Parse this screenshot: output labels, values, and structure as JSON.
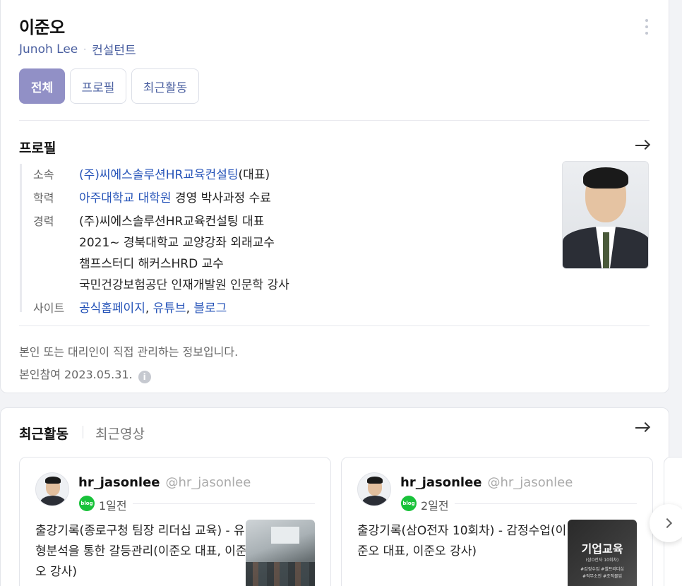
{
  "header": {
    "name": "이준오",
    "english_name": "Junoh Lee",
    "separator": "·",
    "role": "컨설턴트"
  },
  "tabs": [
    {
      "label": "전체",
      "active": true
    },
    {
      "label": "프로필",
      "active": false
    },
    {
      "label": "최근활동",
      "active": false
    }
  ],
  "profile": {
    "title": "프로필",
    "affiliation_label": "소속",
    "affiliation_link": "(주)씨에스솔루션HR교육컨설팅",
    "affiliation_suffix": "(대표)",
    "education_label": "학력",
    "education_link": "아주대학교 대학원",
    "education_suffix": " 경영 박사과정 수료",
    "career_label": "경력",
    "career": [
      "(주)씨에스솔루션HR교육컨설팅 대표",
      "2021~ 경북대학교 교양강좌 외래교수",
      "챔프스터디 해커스HRD 교수",
      "국민건강보험공단 인재개발원 인문학 강사"
    ],
    "site_label": "사이트",
    "sites": [
      "공식홈페이지",
      "유튜브",
      "블로그"
    ],
    "comma": ", "
  },
  "notice": {
    "line1": "본인 또는 대리인이 직접 관리하는 정보입니다.",
    "line2": "본인참여 2023.05.31.",
    "info_glyph": "i"
  },
  "activity": {
    "title": "최근활동",
    "alt_tab": "최근영상",
    "posts": [
      {
        "handle": "hr_jasonlee",
        "at_handle": "@hr_jasonlee",
        "source_icon": "blog",
        "time": "1일전",
        "text": "출강기록(종로구청 팀장 리더십 교육) - 유형분석을 통한 갈등관리(이준오 대표, 이준오 강사)"
      },
      {
        "handle": "hr_jasonlee",
        "at_handle": "@hr_jasonlee",
        "source_icon": "blog",
        "time": "2일전",
        "text": "출강기록(삼O전자 10회차) - 감정수업(이준오 대표, 이준오 강사)",
        "thumb_title": "기업교육",
        "thumb_sub": "(삼O전자 10회차)",
        "thumb_tags1": "#감정수업 #셀프리더십",
        "thumb_tags2": "#직무소진 #조직몰입"
      }
    ]
  },
  "colors": {
    "accent": "#9190c6",
    "link": "#2553b8",
    "meta": "#4a5fa0",
    "blog_green": "#19c23a"
  }
}
